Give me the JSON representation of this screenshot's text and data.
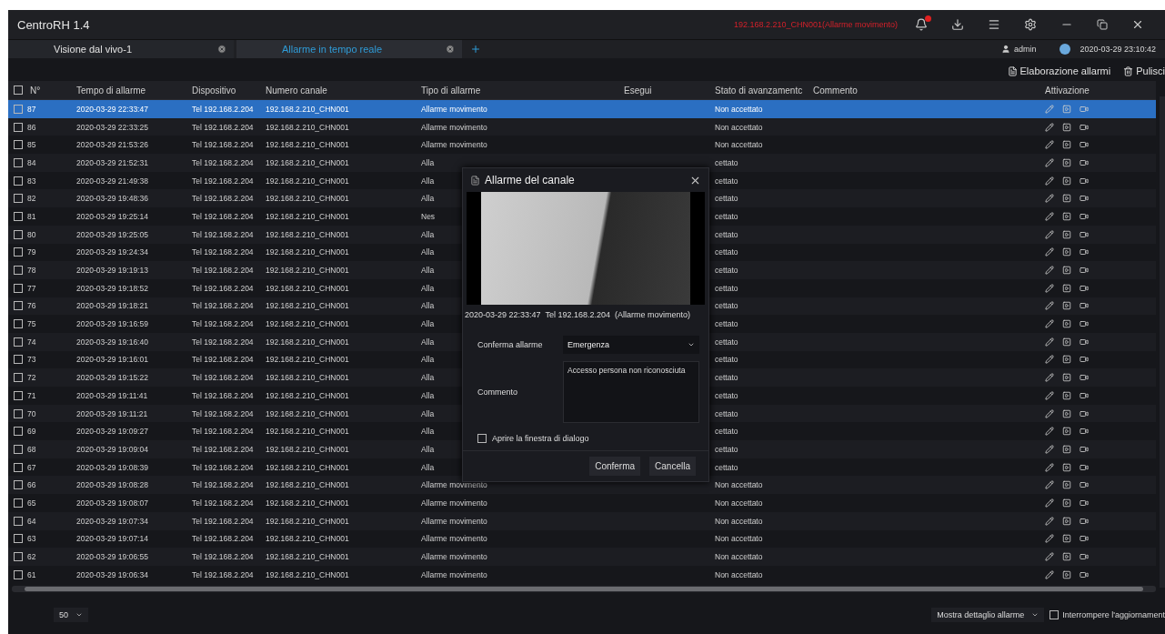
{
  "window": {
    "title": "CentroRH 1.4",
    "alert_text": "192.168.2.210_CHN001(Allarme movimento)"
  },
  "tabs": [
    {
      "label": "Visione dal vivo-1",
      "selected": false
    },
    {
      "label": "Allarme in tempo reale",
      "selected": true
    }
  ],
  "user": {
    "name": "admin",
    "datetime": "2020-03-29 23:10:42"
  },
  "toolbar": [
    "Elaborazione allarmi",
    "Pulisci"
  ],
  "table": {
    "header_checked": false,
    "columns": [
      "N°",
      "Tempo di allarme",
      "Dispositivo",
      "Numero canale",
      "Tipo di allarme",
      "Esegui",
      "Stato di avanzamentc",
      "Commento",
      "Attivazione"
    ],
    "rows": [
      {
        "n": "87",
        "time": "2020-03-29 22:33:47",
        "device": "Tel 192.168.2.204",
        "channel": "192.168.2.210_CHN001",
        "type": "Allarme movimento",
        "status": "Non accettato",
        "checked": false,
        "selected": true
      },
      {
        "n": "86",
        "time": "2020-03-29 22:33:25",
        "device": "Tel 192.168.2.204",
        "channel": "192.168.2.210_CHN001",
        "type": "Allarme movimento",
        "status": "Non accettato",
        "checked": false,
        "selected": false
      },
      {
        "n": "85",
        "time": "2020-03-29 21:53:26",
        "device": "Tel 192.168.2.204",
        "channel": "192.168.2.210_CHN001",
        "type": "Allarme movimento",
        "status": "Non accettato",
        "checked": false,
        "selected": false
      },
      {
        "n": "84",
        "time": "2020-03-29 21:52:31",
        "device": "Tel 192.168.2.204",
        "channel": "192.168.2.210_CHN001",
        "type": "Alla",
        "status": "cettato",
        "checked": false,
        "selected": false
      },
      {
        "n": "83",
        "time": "2020-03-29 21:49:38",
        "device": "Tel 192.168.2.204",
        "channel": "192.168.2.210_CHN001",
        "type": "Alla",
        "status": "cettato",
        "checked": false,
        "selected": false
      },
      {
        "n": "82",
        "time": "2020-03-29 19:48:36",
        "device": "Tel 192.168.2.204",
        "channel": "192.168.2.210_CHN001",
        "type": "Alla",
        "status": "cettato",
        "checked": false,
        "selected": false
      },
      {
        "n": "81",
        "time": "2020-03-29 19:25:14",
        "device": "Tel 192.168.2.204",
        "channel": "192.168.2.210_CHN001",
        "type": "Nes",
        "status": "cettato",
        "checked": false,
        "selected": false
      },
      {
        "n": "80",
        "time": "2020-03-29 19:25:05",
        "device": "Tel 192.168.2.204",
        "channel": "192.168.2.210_CHN001",
        "type": "Alla",
        "status": "cettato",
        "checked": false,
        "selected": false
      },
      {
        "n": "79",
        "time": "2020-03-29 19:24:34",
        "device": "Tel 192.168.2.204",
        "channel": "192.168.2.210_CHN001",
        "type": "Alla",
        "status": "cettato",
        "checked": false,
        "selected": false
      },
      {
        "n": "78",
        "time": "2020-03-29 19:19:13",
        "device": "Tel 192.168.2.204",
        "channel": "192.168.2.210_CHN001",
        "type": "Alla",
        "status": "cettato",
        "checked": false,
        "selected": false
      },
      {
        "n": "77",
        "time": "2020-03-29 19:18:52",
        "device": "Tel 192.168.2.204",
        "channel": "192.168.2.210_CHN001",
        "type": "Alla",
        "status": "cettato",
        "checked": false,
        "selected": false
      },
      {
        "n": "76",
        "time": "2020-03-29 19:18:21",
        "device": "Tel 192.168.2.204",
        "channel": "192.168.2.210_CHN001",
        "type": "Alla",
        "status": "cettato",
        "checked": false,
        "selected": false
      },
      {
        "n": "75",
        "time": "2020-03-29 19:16:59",
        "device": "Tel 192.168.2.204",
        "channel": "192.168.2.210_CHN001",
        "type": "Alla",
        "status": "cettato",
        "checked": false,
        "selected": false
      },
      {
        "n": "74",
        "time": "2020-03-29 19:16:40",
        "device": "Tel 192.168.2.204",
        "channel": "192.168.2.210_CHN001",
        "type": "Alla",
        "status": "cettato",
        "checked": false,
        "selected": false
      },
      {
        "n": "73",
        "time": "2020-03-29 19:16:01",
        "device": "Tel 192.168.2.204",
        "channel": "192.168.2.210_CHN001",
        "type": "Alla",
        "status": "cettato",
        "checked": false,
        "selected": false
      },
      {
        "n": "72",
        "time": "2020-03-29 19:15:22",
        "device": "Tel 192.168.2.204",
        "channel": "192.168.2.210_CHN001",
        "type": "Alla",
        "status": "cettato",
        "checked": false,
        "selected": false
      },
      {
        "n": "71",
        "time": "2020-03-29 19:11:41",
        "device": "Tel 192.168.2.204",
        "channel": "192.168.2.210_CHN001",
        "type": "Alla",
        "status": "cettato",
        "checked": false,
        "selected": false
      },
      {
        "n": "70",
        "time": "2020-03-29 19:11:21",
        "device": "Tel 192.168.2.204",
        "channel": "192.168.2.210_CHN001",
        "type": "Alla",
        "status": "cettato",
        "checked": false,
        "selected": false
      },
      {
        "n": "69",
        "time": "2020-03-29 19:09:27",
        "device": "Tel 192.168.2.204",
        "channel": "192.168.2.210_CHN001",
        "type": "Alla",
        "status": "cettato",
        "checked": false,
        "selected": false
      },
      {
        "n": "68",
        "time": "2020-03-29 19:09:04",
        "device": "Tel 192.168.2.204",
        "channel": "192.168.2.210_CHN001",
        "type": "Alla",
        "status": "cettato",
        "checked": false,
        "selected": false
      },
      {
        "n": "67",
        "time": "2020-03-29 19:08:39",
        "device": "Tel 192.168.2.204",
        "channel": "192.168.2.210_CHN001",
        "type": "Alla",
        "status": "cettato",
        "checked": false,
        "selected": false
      },
      {
        "n": "66",
        "time": "2020-03-29 19:08:28",
        "device": "Tel 192.168.2.204",
        "channel": "192.168.2.210_CHN001",
        "type": "Allarme movimento",
        "status": "Non accettato",
        "checked": false,
        "selected": false
      },
      {
        "n": "65",
        "time": "2020-03-29 19:08:07",
        "device": "Tel 192.168.2.204",
        "channel": "192.168.2.210_CHN001",
        "type": "Allarme movimento",
        "status": "Non accettato",
        "checked": false,
        "selected": false
      },
      {
        "n": "64",
        "time": "2020-03-29 19:07:34",
        "device": "Tel 192.168.2.204",
        "channel": "192.168.2.210_CHN001",
        "type": "Allarme movimento",
        "status": "Non accettato",
        "checked": false,
        "selected": false
      },
      {
        "n": "63",
        "time": "2020-03-29 19:07:14",
        "device": "Tel 192.168.2.204",
        "channel": "192.168.2.210_CHN001",
        "type": "Allarme movimento",
        "status": "Non accettato",
        "checked": false,
        "selected": false
      },
      {
        "n": "62",
        "time": "2020-03-29 19:06:55",
        "device": "Tel 192.168.2.204",
        "channel": "192.168.2.210_CHN001",
        "type": "Allarme movimento",
        "status": "Non accettato",
        "checked": false,
        "selected": false
      },
      {
        "n": "61",
        "time": "2020-03-29 19:06:34",
        "device": "Tel 192.168.2.204",
        "channel": "192.168.2.210_CHN001",
        "type": "Allarme movimento",
        "status": "Non accettato",
        "checked": false,
        "selected": false
      }
    ]
  },
  "dialog": {
    "title": "Allarme del canale",
    "caption": "2020-03-29 22:33:47  Tel 192.168.2.204  (Allarme movimento)",
    "confirm_label": "Conferma allarme",
    "confirm_value": "Emergenza",
    "comment_label": "Commento",
    "comment_value": "Accesso persona non riconosciuta",
    "open_dialog": {
      "label": "Aprire la finestra di dialogo",
      "checked": false
    },
    "buttons": [
      "Conferma",
      "Cancella"
    ]
  },
  "footer": {
    "page_size": "50",
    "detail_select": "Mostra dettaglio allarme",
    "stop_refresh": {
      "label": "Interrompere l'aggiornament",
      "checked": false
    }
  }
}
